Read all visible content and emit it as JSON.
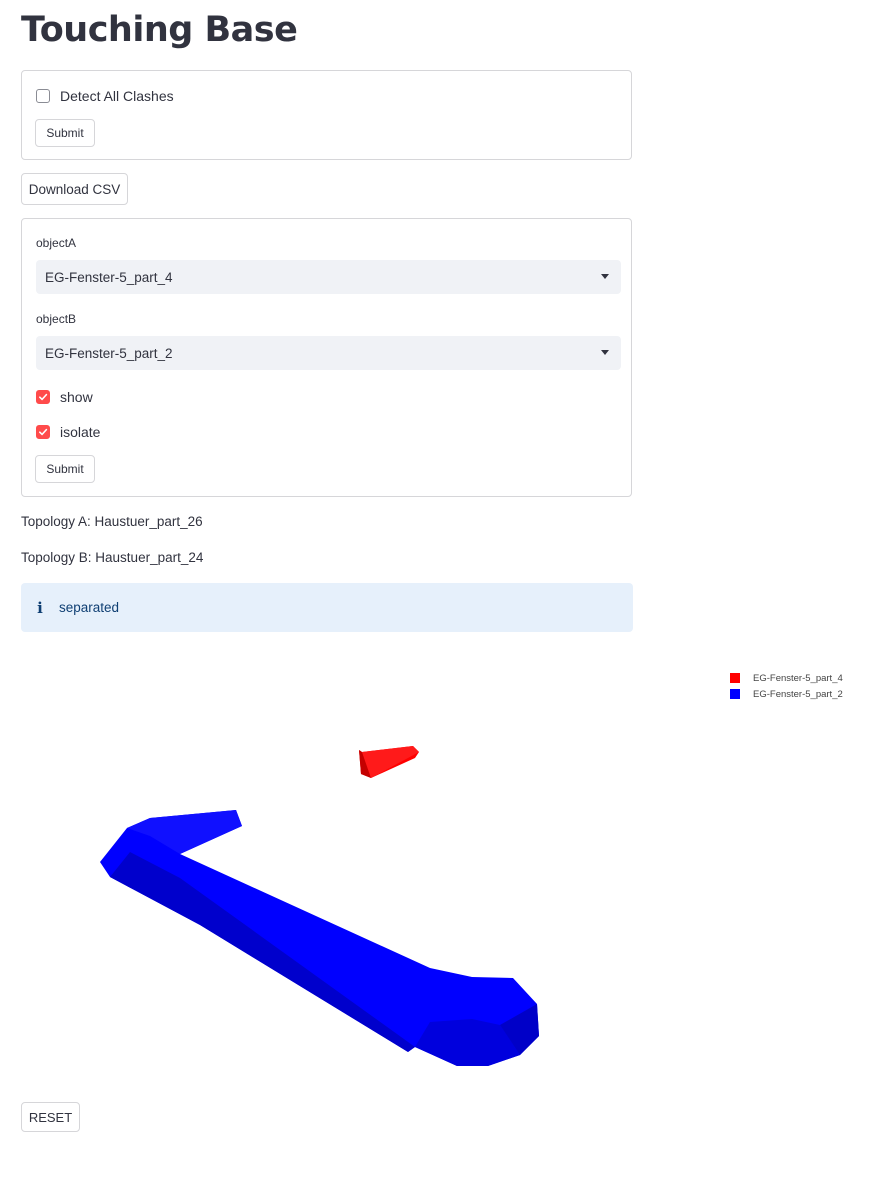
{
  "page": {
    "title": "Touching Base"
  },
  "clash_form": {
    "detect_all_label": "Detect All Clashes",
    "detect_all_checked": false,
    "submit_label": "Submit"
  },
  "download_label": "Download CSV",
  "pair_form": {
    "object_a_label": "objectA",
    "object_a_value": "EG-Fenster-5_part_4",
    "object_b_label": "objectB",
    "object_b_value": "EG-Fenster-5_part_2",
    "show_label": "show",
    "show_checked": true,
    "isolate_label": "isolate",
    "isolate_checked": true,
    "submit_label": "Submit"
  },
  "topology": {
    "a": "Topology A: Haustuer_part_26",
    "b": "Topology B: Haustuer_part_24"
  },
  "info": {
    "icon": "info-icon",
    "message": "separated"
  },
  "viewer": {
    "legend": [
      {
        "name": "EG-Fenster-5_part_4",
        "color": "#ff0000"
      },
      {
        "name": "EG-Fenster-5_part_2",
        "color": "#0000ff"
      }
    ]
  },
  "reset_label": "RESET",
  "colors": {
    "accent": "#ff4b4b",
    "info_bg": "#e6f0fb",
    "info_text": "#0f3f73",
    "select_bg": "#f0f2f6"
  }
}
